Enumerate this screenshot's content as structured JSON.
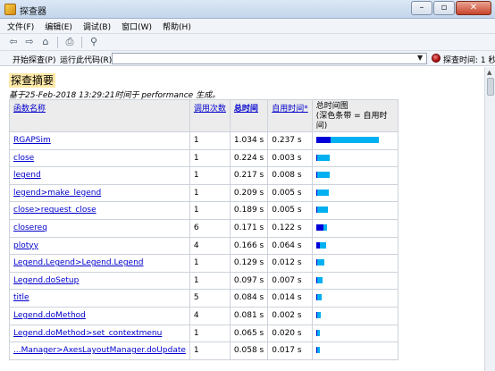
{
  "window": {
    "title": "探查器"
  },
  "menu": [
    "文件(F)",
    "编辑(E)",
    "调试(B)",
    "窗口(W)",
    "帮助(H)"
  ],
  "toolbar": {
    "icons": [
      "back-arrow-icon",
      "forward-arrow-icon",
      "home-icon",
      "print-icon",
      "find-icon"
    ]
  },
  "runbar": {
    "start_label": "开始探查(P)",
    "run_label": "运行此代码(R):",
    "code_value": "",
    "timer_label": "探查时间: 1 秒"
  },
  "report": {
    "heading": "探查摘要",
    "subline": "基于25-Feb-2018 13:29:21时间于 performance 生成。",
    "columns": {
      "name": "函数名称",
      "calls": "调用次数",
      "total": "总时间",
      "self": "自用时间*",
      "graph": "总时间图\n(深色条带 = 自用时间)"
    },
    "rows": [
      {
        "name": "RGAPSim",
        "calls": "1",
        "total": "1.034 s",
        "self": "0.237 s",
        "total_val": 1.034,
        "self_val": 0.237
      },
      {
        "name": "close",
        "calls": "1",
        "total": "0.224 s",
        "self": "0.003 s",
        "total_val": 0.224,
        "self_val": 0.003
      },
      {
        "name": "legend",
        "calls": "1",
        "total": "0.217 s",
        "self": "0.008 s",
        "total_val": 0.217,
        "self_val": 0.008
      },
      {
        "name": "legend>make_legend",
        "calls": "1",
        "total": "0.209 s",
        "self": "0.005 s",
        "total_val": 0.209,
        "self_val": 0.005
      },
      {
        "name": "close>request_close",
        "calls": "1",
        "total": "0.189 s",
        "self": "0.005 s",
        "total_val": 0.189,
        "self_val": 0.005
      },
      {
        "name": "closereq",
        "calls": "6",
        "total": "0.171 s",
        "self": "0.122 s",
        "total_val": 0.171,
        "self_val": 0.122
      },
      {
        "name": "plotyy",
        "calls": "4",
        "total": "0.166 s",
        "self": "0.064 s",
        "total_val": 0.166,
        "self_val": 0.064
      },
      {
        "name": "Legend.Legend>Legend.Legend",
        "calls": "1",
        "total": "0.129 s",
        "self": "0.012 s",
        "total_val": 0.129,
        "self_val": 0.012
      },
      {
        "name": "Legend.doSetup",
        "calls": "1",
        "total": "0.097 s",
        "self": "0.007 s",
        "total_val": 0.097,
        "self_val": 0.007
      },
      {
        "name": "title",
        "calls": "5",
        "total": "0.084 s",
        "self": "0.014 s",
        "total_val": 0.084,
        "self_val": 0.014
      },
      {
        "name": "Legend.doMethod",
        "calls": "4",
        "total": "0.081 s",
        "self": "0.002 s",
        "total_val": 0.081,
        "self_val": 0.002
      },
      {
        "name": "Legend.doMethod>set_contextmenu",
        "calls": "1",
        "total": "0.065 s",
        "self": "0.020 s",
        "total_val": 0.065,
        "self_val": 0.02
      },
      {
        "name": "...Manager>AxesLayoutManager.doUpdate",
        "calls": "1",
        "total": "0.058 s",
        "self": "0.017 s",
        "total_val": 0.058,
        "self_val": 0.017
      }
    ]
  },
  "colors": {
    "self_bar": "#0000d8",
    "total_bar": "#00b0f0",
    "heading_bg": "#ffe9a8",
    "link": "#0000cc"
  }
}
